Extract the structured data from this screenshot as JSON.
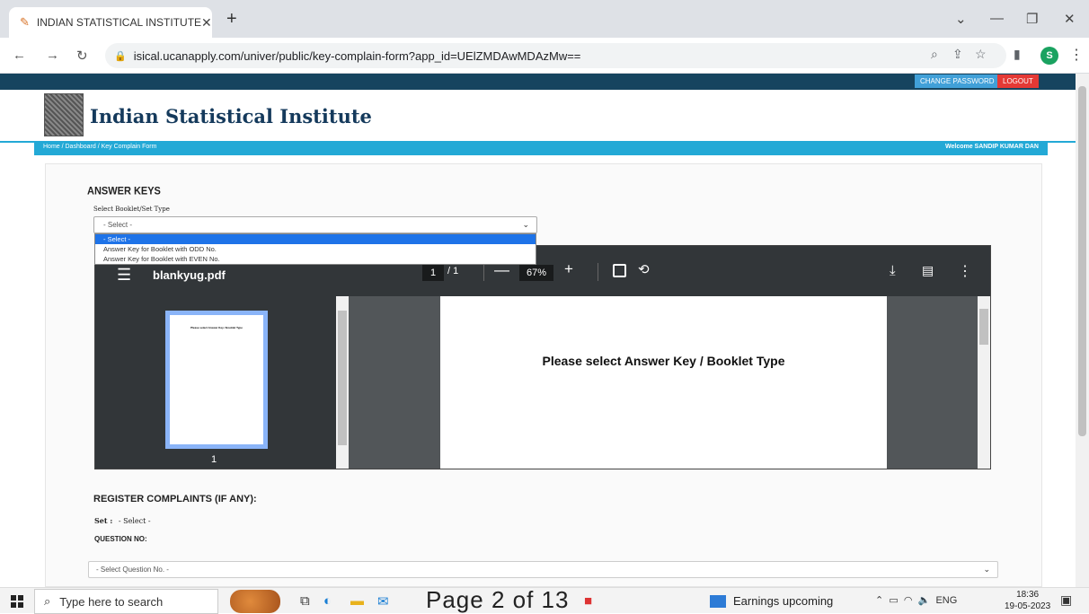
{
  "browser": {
    "tab_title": "INDIAN STATISTICAL INSTITUTE",
    "url": "isical.ucanapply.com/univer/public/key-complain-form?app_id=UElZMDAwMDAzMw==",
    "profile_initial": "S"
  },
  "site": {
    "name": "Indian Statistical Institute",
    "change_password": "CHANGE PASSWORD",
    "logout": "LOGOUT",
    "breadcrumb": "Home  /  Dashboard  /  Key Complain Form",
    "welcome": "Welcome SANDIP KUMAR DAN"
  },
  "answer_keys": {
    "heading": "ANSWER KEYS",
    "select_label": "Select Booklet/Set Type",
    "select_value": "- Select -",
    "options": [
      "- Select -",
      "Answer Key for Booklet with ODD No.",
      "Answer Key for Booklet with EVEN No."
    ]
  },
  "pdf": {
    "filename": "blankyug.pdf",
    "page": "1",
    "page_total": "/  1",
    "zoom": "67%",
    "thumb_number": "1",
    "message": "Please select Answer Key / Booklet Type"
  },
  "complaints": {
    "heading": "REGISTER COMPLAINTS (IF ANY):",
    "set_label": "Set :",
    "set_value": "- Select -",
    "question_label": "QUESTION NO:",
    "question_select": "- Select Question No. -"
  },
  "taskbar": {
    "search_placeholder": "Type here to search",
    "overlay": "Page 2 of 13",
    "earnings": "Earnings upcoming",
    "lang": "ENG",
    "time": "18:36",
    "date": "19-05-2023"
  }
}
